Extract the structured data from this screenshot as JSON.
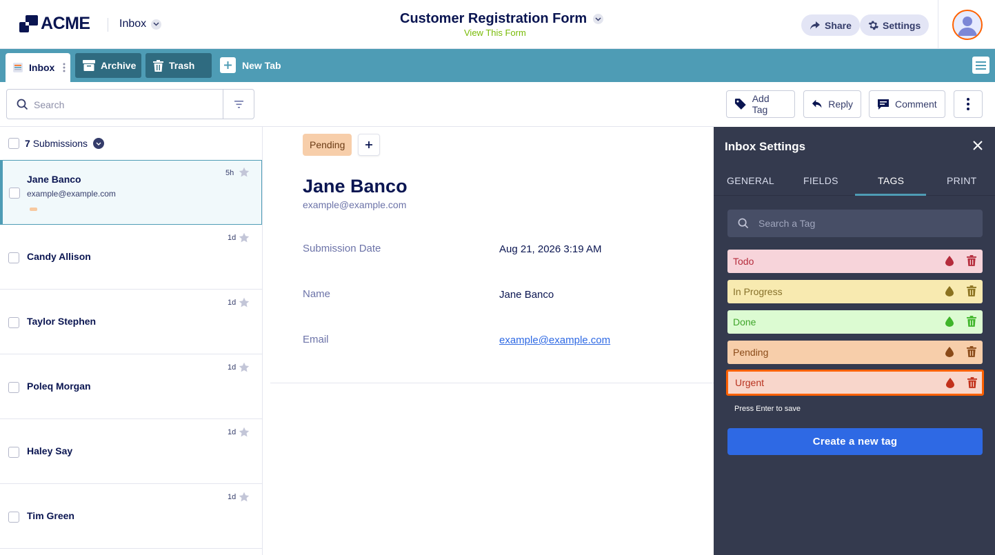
{
  "header": {
    "logo_text": "ACME",
    "inbox_label": "Inbox",
    "form_title": "Customer Registration Form",
    "view_form_link": "View This Form",
    "share_label": "Share",
    "settings_label": "Settings"
  },
  "tabs": {
    "active": "Inbox",
    "archive": "Archive",
    "trash": "Trash",
    "new_tab": "New Tab"
  },
  "toolbar": {
    "search_placeholder": "Search",
    "add_tag": "Add Tag",
    "reply": "Reply",
    "comment": "Comment"
  },
  "list": {
    "count": "7",
    "count_label": "Submissions",
    "items": [
      {
        "name": "Jane Banco",
        "email": "example@example.com",
        "time": "5h",
        "selected": true
      },
      {
        "name": "Candy Allison",
        "time": "1d"
      },
      {
        "name": "Taylor Stephen",
        "time": "1d"
      },
      {
        "name": "Poleq Morgan",
        "time": "1d"
      },
      {
        "name": "Haley Say",
        "time": "1d"
      },
      {
        "name": "Tim Green",
        "time": "1d"
      }
    ]
  },
  "detail": {
    "tag": "Pending",
    "name": "Jane Banco",
    "email": "example@example.com",
    "fields": [
      {
        "label": "Submission Date",
        "value": "Aug 21, 2026 3:19 AM"
      },
      {
        "label": "Name",
        "value": "Jane Banco"
      },
      {
        "label": "Email",
        "value": "example@example.com"
      }
    ]
  },
  "settings_panel": {
    "title": "Inbox Settings",
    "tabs": [
      "GENERAL",
      "FIELDS",
      "TAGS",
      "PRINT"
    ],
    "active_tab": "TAGS",
    "search_placeholder": "Search a Tag",
    "tags": [
      {
        "label": "Todo",
        "bg": "#f7d4da",
        "fg": "#b52c3c"
      },
      {
        "label": "In Progress",
        "bg": "#f8eab0",
        "fg": "#86702a"
      },
      {
        "label": "Done",
        "bg": "#dcfbd2",
        "fg": "#3fa52a"
      },
      {
        "label": "Pending",
        "bg": "#f7ceaa",
        "fg": "#8a4a18"
      },
      {
        "label": "Urgent",
        "bg": "#f8d6cb",
        "fg": "#b8321f",
        "editing": true
      }
    ],
    "hint": "Press Enter to save",
    "create_button": "Create a new tag"
  }
}
